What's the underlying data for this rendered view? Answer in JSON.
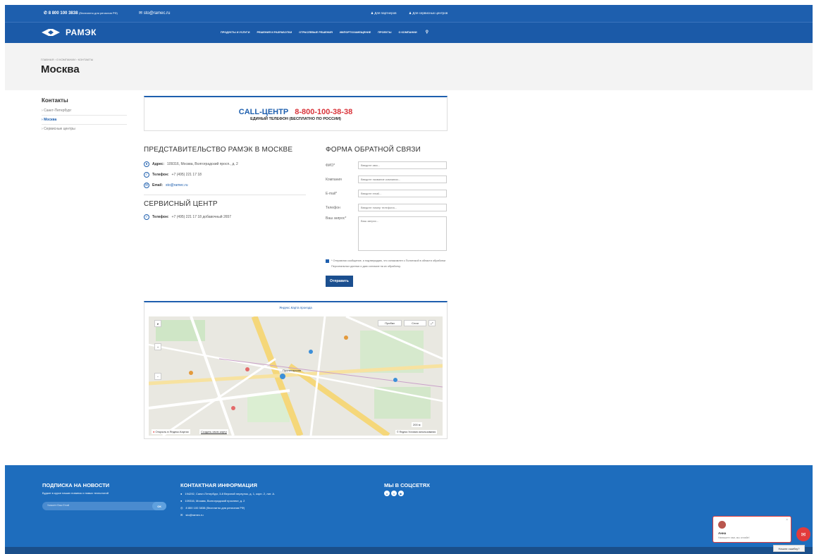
{
  "topbar": {
    "phone": "8 800 100 3838",
    "phone_note": "(бесплатно для регионов РФ)",
    "email": "sto@ramec.ru",
    "partners": "Для партнеров",
    "service_centers": "Для сервисных центров"
  },
  "brand": {
    "name": "РАМЭК"
  },
  "nav": {
    "items": [
      "ПРОДУКТЫ И УСЛУГИ",
      "РЕШЕНИЯ И РАЗРАБОТКИ",
      "ОТРАСЛЕВЫЕ РЕШЕНИЯ",
      "ИМПОРТОЗАМЕЩЕНИЕ",
      "ПРОЕКТЫ",
      "О КОМПАНИИ"
    ]
  },
  "breadcrumb": {
    "items": [
      "ГЛАВНАЯ",
      "О КОМПАНИИ",
      "КОНТАКТЫ"
    ]
  },
  "page": {
    "title": "Москва"
  },
  "sidebar": {
    "title": "Контакты",
    "items": [
      {
        "label": "Санкт-Петербург"
      },
      {
        "label": "Москва"
      },
      {
        "label": "Сервисные центры"
      }
    ]
  },
  "callcenter": {
    "label": "CALL-ЦЕНТР",
    "number": "8-800-100-38-38",
    "subtitle": "ЕДИНЫЙ ТЕЛЕФОН (БЕСПЛАТНО ПО РОССИИ)"
  },
  "office": {
    "title": "ПРЕДСТАВИТЕЛЬСТВО РАМЭК В МОСКВЕ",
    "address_label": "Адрес:",
    "address": "109316, Москва, Волгоградский просп., д. 2",
    "phone_label": "Телефон:",
    "phone": "+7 (495) 221 17 18",
    "email_label": "Email:",
    "email": "sto@ramec.ru"
  },
  "service": {
    "title": "СЕРВИСНЫЙ ЦЕНТР",
    "phone_label": "Телефон:",
    "phone": "+7 (495) 221 17 18 добавочный 2657"
  },
  "form": {
    "title": "ФОРМА ОБРАТНОЙ СВЯЗИ",
    "fio_label": "ФИО*",
    "fio_placeholder": "Введите имя...",
    "company_label": "Компания",
    "company_placeholder": "Введите название компании...",
    "email_label": "E-mail*",
    "email_placeholder": "Введите email...",
    "phone_label": "Телефон",
    "phone_placeholder": "Введите номер телефона...",
    "request_label": "Ваш запрос*",
    "request_placeholder": "Ваш запрос...",
    "agree_text": "* Отправляя сообщение, я подтверждаю, что ознакомлен с Политикой в области обработки Персональных данных и даю согласие на их обработку.",
    "submit": "Отправить"
  },
  "map": {
    "title": "Яндекс.Карта проезда",
    "traffic": "Пробки",
    "layers": "Слои",
    "open_link": "Открыть в Яндекс.Картах",
    "create_link": "Создать свою карту",
    "scale": "200 м",
    "terms": "© Яндекс Условия использования",
    "station": "Пролетарская"
  },
  "footer": {
    "news_title": "ПОДПИСКА НА НОВОСТИ",
    "news_sub": "Будьте в курсе наших новинок и новых технологий",
    "news_placeholder": "Укажите Ваш Email",
    "news_button": "ОК",
    "contact_title": "КОНТАКТНАЯ ИНФОРМАЦИЯ",
    "contact_items": [
      "194292, Санкт-Петербург, 3-й Верхний переулок, д. 1, корп. 2, лит. А.",
      "109316, Москва, Волгоградский проспект, д. 2",
      "8 800 100 3838 (бесплатно для регионов РФ)",
      "sto@ramec.ru"
    ],
    "social_title": "МЫ В СОЦСЕТЯХ"
  },
  "chat": {
    "name": "Анна",
    "message": "Напишите нам, мы онлайн!",
    "found_error": "Нашли ошибку?"
  },
  "colors": {
    "brand_blue": "#1e5fae",
    "accent_red": "#d9343a",
    "footer_blue": "#1e6dbd"
  }
}
